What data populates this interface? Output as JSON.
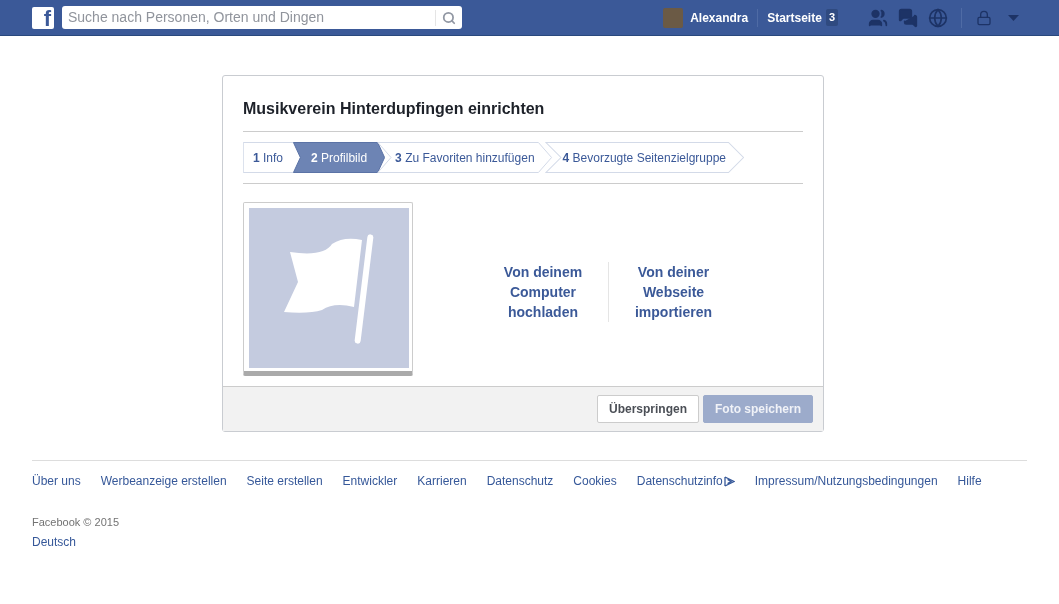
{
  "topbar": {
    "logo": "f",
    "search": {
      "placeholder": "Suche nach Personen, Orten und Dingen"
    },
    "user": "Alexandra",
    "home": {
      "label": "Startseite",
      "count": "3"
    }
  },
  "dialog": {
    "title": "Musikverein Hinterdupfingen einrichten",
    "steps": [
      {
        "number": "1",
        "label": "Info",
        "selected": false
      },
      {
        "number": "2",
        "label": "Profilbild",
        "selected": true
      },
      {
        "number": "3",
        "label": "Zu Favoriten hinzufügen",
        "selected": false
      },
      {
        "number": "4",
        "label": "Bevorzugte Seitenzielgruppe",
        "selected": false
      }
    ],
    "upload_options": [
      "Von deinem Computer hochladen",
      "Von deiner Webseite importieren"
    ],
    "buttons": [
      {
        "label": "Überspringen",
        "disabled": false
      },
      {
        "label": "Foto speichern",
        "disabled": true
      }
    ]
  },
  "footer": {
    "links": [
      "Über uns",
      "Werbeanzeige erstellen",
      "Seite erstellen",
      "Entwickler",
      "Karrieren",
      "Datenschutz",
      "Cookies",
      "Datenschutzinfo",
      "Impressum/Nutzungsbedingungen",
      "Hilfe"
    ],
    "copyright": "Facebook © 2015",
    "language": "Deutsch"
  }
}
